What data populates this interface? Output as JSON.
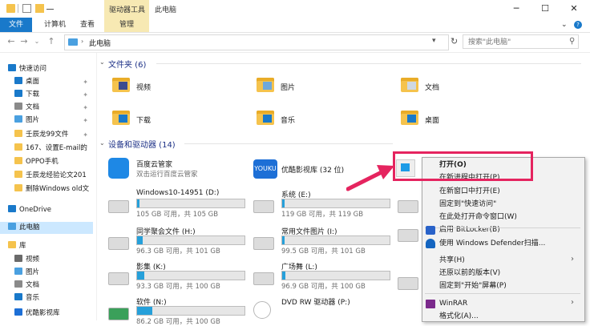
{
  "titlebar": {
    "context_tab_label": "驱动器工具",
    "title": "此电脑",
    "min": "─",
    "max": "☐",
    "close": "✕"
  },
  "ribbon": {
    "tabs": [
      "文件",
      "计算机",
      "查看",
      "管理"
    ],
    "help": "?"
  },
  "address": {
    "path": "此电脑",
    "dropdown": "▾",
    "refresh": "↻",
    "search_placeholder": "搜索\"此电脑\""
  },
  "nav": {
    "items": [
      {
        "label": "快速访问",
        "icon": "star-icon",
        "pinned": false
      },
      {
        "label": "桌面",
        "icon": "desktop-icon",
        "pinned": true
      },
      {
        "label": "下载",
        "icon": "download-icon",
        "pinned": true
      },
      {
        "label": "文档",
        "icon": "document-icon",
        "pinned": true
      },
      {
        "label": "图片",
        "icon": "picture-icon",
        "pinned": true
      },
      {
        "label": "壬辰龙99文件",
        "icon": "folder-icon",
        "pinned": true
      },
      {
        "label": "167、设置E-mail的",
        "icon": "folder-icon",
        "pinned": false
      },
      {
        "label": "OPPO手机",
        "icon": "folder-icon",
        "pinned": false
      },
      {
        "label": "壬辰龙经验论文201",
        "icon": "folder-icon",
        "pinned": false
      },
      {
        "label": "删除Windows old文",
        "icon": "folder-icon",
        "pinned": false
      },
      {
        "label": "OneDrive",
        "icon": "cloud-icon",
        "pinned": false
      },
      {
        "label": "此电脑",
        "icon": "computer-icon",
        "pinned": false
      },
      {
        "label": "库",
        "icon": "library-icon",
        "pinned": false
      },
      {
        "label": "视频",
        "icon": "video-icon",
        "pinned": false
      },
      {
        "label": "图片",
        "icon": "picture-icon",
        "pinned": false
      },
      {
        "label": "文档",
        "icon": "document-icon",
        "pinned": false
      },
      {
        "label": "音乐",
        "icon": "music-icon",
        "pinned": false
      },
      {
        "label": "优酷影视库",
        "icon": "youku-icon",
        "pinned": false
      }
    ]
  },
  "folders_section": {
    "title": "文件夹 (6)",
    "items": [
      "视频",
      "图片",
      "文档",
      "下载",
      "音乐",
      "桌面"
    ]
  },
  "devices_section": {
    "title": "设备和驱动器 (14)",
    "apps": [
      {
        "name": "百度云管家",
        "sub": "双击运行百度云管家"
      },
      {
        "name": "优酷影视库 (32 位)",
        "sub": ""
      }
    ],
    "drives": [
      {
        "name": "Windows10-14951 (D:)",
        "info": "105 GB 可用，共 105 GB",
        "fill": 0.02
      },
      {
        "name": "系统 (E:)",
        "info": "119 GB 可用，共 119 GB",
        "fill": 0.02
      },
      {
        "name": "同学聚会文件 (H:)",
        "info": "96.3 GB 可用，共 101 GB",
        "fill": 0.05
      },
      {
        "name": "常用文件图片 (I:)",
        "info": "99.5 GB 可用，共 101 GB",
        "fill": 0.02
      },
      {
        "name": "影集 (K:)",
        "info": "93.3 GB 可用，共 100 GB",
        "fill": 0.07
      },
      {
        "name": "广场舞 (L:)",
        "info": "96.9 GB 可用，共 100 GB",
        "fill": 0.03
      },
      {
        "name": "软件 (N:)",
        "info": "86.2 GB 可用，共 100 GB",
        "fill": 0.14
      },
      {
        "name": "DVD RW 驱动器 (P:)",
        "info": "",
        "fill": 0
      }
    ]
  },
  "context_menu": {
    "items": [
      "打开(O)",
      "在新进程中打开(P)",
      "在新窗口中打开(E)",
      "固定到\"快速访问\"",
      "在此处打开命令窗口(W)",
      "启用 BitLocker(B)",
      "使用 Windows Defender扫描...",
      "共享(H)",
      "还原以前的版本(V)",
      "固定到\"开始\"屏幕(P)",
      "WinRAR",
      "格式化(A)..."
    ],
    "submenu_arrow": "›"
  },
  "colors": {
    "file_tab": "#1979ca",
    "context_tab": "#f7e9b3",
    "highlight": "#e5245f",
    "drive_fill": "#26a0da"
  }
}
